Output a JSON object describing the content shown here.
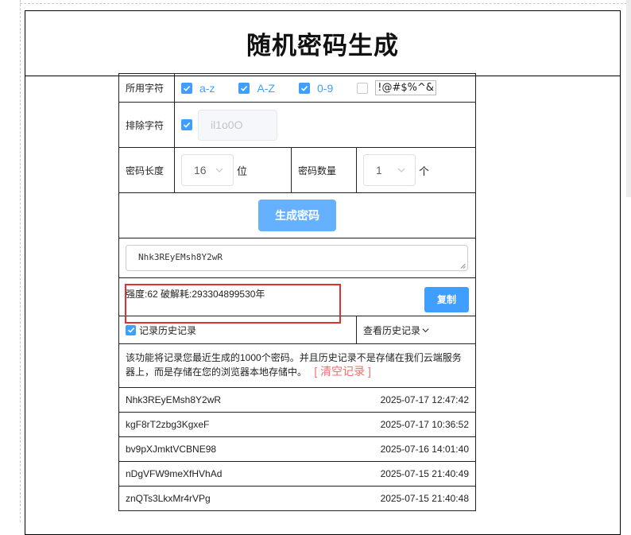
{
  "page": {
    "title": "随机密码生成"
  },
  "chars": {
    "label": "所用字符",
    "options": [
      {
        "label": "a-z",
        "checked": true
      },
      {
        "label": "A-Z",
        "checked": true
      },
      {
        "label": "0-9",
        "checked": true
      },
      {
        "label": "!@#$%^&",
        "checked": false
      }
    ]
  },
  "exclude": {
    "label": "排除字符",
    "checked": true,
    "value": "il1o0O"
  },
  "length": {
    "label": "密码长度",
    "value": "16",
    "unit": "位"
  },
  "count": {
    "label": "密码数量",
    "value": "1",
    "unit": "个"
  },
  "generate_button": "生成密码",
  "output": {
    "password": "Nhk3REyEMsh8Y2wR"
  },
  "strength": {
    "text": "强度:62 破解耗:293304899530年"
  },
  "copy_button": "复制",
  "history": {
    "toggle_label": "记录历史记录",
    "toggle_checked": true,
    "view_label": "查看历史记录",
    "notice": "该功能将记录您最近生成的1000个密码。并且历史记录不是存储在我们云端服务器上，而是存储在您的浏览器本地存储中。",
    "clear_label": "[ 清空记录 ]",
    "entries": [
      {
        "password": "Nhk3REyEMsh8Y2wR",
        "time": "2025-07-17 12:47:42"
      },
      {
        "password": "kgF8rT2zbg3KgxeF",
        "time": "2025-07-17 10:36:52"
      },
      {
        "password": "bv9pXJmktVCBNE98",
        "time": "2025-07-16 14:01:40"
      },
      {
        "password": "nDgVFW9meXfHVhAd",
        "time": "2025-07-15 21:40:49"
      },
      {
        "password": "znQTs3LkxMr4rVPg",
        "time": "2025-07-15 21:40:48"
      }
    ]
  },
  "colors": {
    "accent": "#409eff",
    "accent_light": "#66b1ff",
    "danger": "#f56c6c",
    "highlight_box": "#e03030"
  },
  "icons": {
    "checkbox_check": "check-icon",
    "select_arrow": "chevron-down-icon",
    "history_dropdown": "chevron-down-icon",
    "textarea_resize": "resize-grip-icon"
  }
}
